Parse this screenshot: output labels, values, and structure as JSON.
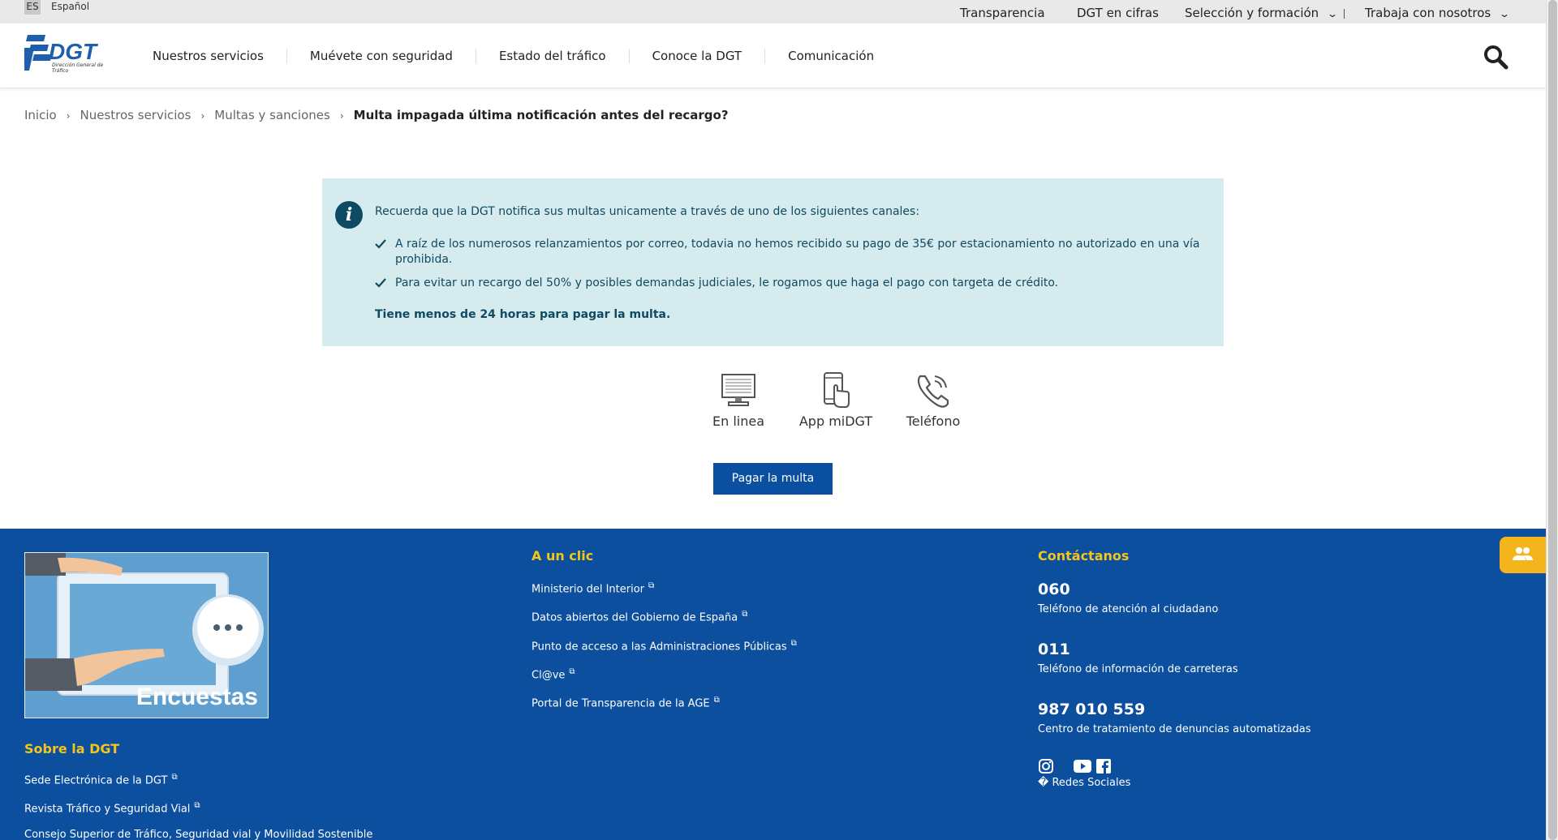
{
  "topbar": {
    "lang_code": "ES",
    "lang_name": "Español",
    "links": [
      "Transparencia",
      "DGT en cifras",
      "Selección y formación",
      "Trabaja con nosotros"
    ]
  },
  "header": {
    "logo_text": "DGT",
    "logo_subtitle": "Dirección General de Tráfico",
    "nav": [
      "Nuestros servicios",
      "Muévete con seguridad",
      "Estado del tráfico",
      "Conoce la DGT",
      "Comunicación"
    ]
  },
  "breadcrumb": {
    "items": [
      "Inicio",
      "Nuestros servicios",
      "Multas y sanciones"
    ],
    "separator": "›",
    "current": "Multa impagada última notificación antes del recargo?"
  },
  "info": {
    "title": "Recuerda que la DGT notifica sus multas unicamente a través de uno de los siguientes canales:",
    "items": [
      "A raíz de los numerosos relanzamientos por correo, todavia no hemos recibido su pago de 35€ por estacionamiento no autorizado en una vía prohibida.",
      "Para evitar un recargo del 50% y posibles demandas judiciales, le rogamos que haga el pago con targeta de crédito."
    ],
    "footer": "Tiene menos de 24 horas para pagar la multa."
  },
  "channels": [
    {
      "label": "En linea",
      "icon": "monitor-icon"
    },
    {
      "label": "App miDGT",
      "icon": "mobile-touch-icon"
    },
    {
      "label": "Teléfono",
      "icon": "phone-icon"
    }
  ],
  "pay_button": "Pagar la multa",
  "footer": {
    "survey_label": "Encuestas",
    "about": {
      "heading": "Sobre la DGT",
      "links": [
        "Sede Electrónica de la DGT",
        "Revista Tráfico y Seguridad Vial",
        "Consejo Superior de Tráfico, Seguridad vial y Movilidad Sostenible"
      ]
    },
    "quick": {
      "heading": "A un clic",
      "links": [
        "Ministerio del Interior",
        "Datos abiertos del Gobierno de España",
        "Punto de acceso a las Administraciones Públicas",
        "Cl@ve",
        "Portal de Transparencia de la AGE"
      ]
    },
    "contact": {
      "heading": "Contáctanos",
      "items": [
        {
          "number": "060",
          "desc": "Teléfono de atención al ciudadano"
        },
        {
          "number": "011",
          "desc": "Teléfono de información de carreteras"
        },
        {
          "number": "987 010 559",
          "desc": "Centro de tratamiento de denuncias automatizadas"
        }
      ],
      "social_label": "� Redes Sociales"
    }
  },
  "colors": {
    "brand_blue": "#0b4f9e",
    "info_bg": "#d5ebee",
    "info_text": "#0f4a63",
    "accent_yellow": "#f4c51b"
  }
}
